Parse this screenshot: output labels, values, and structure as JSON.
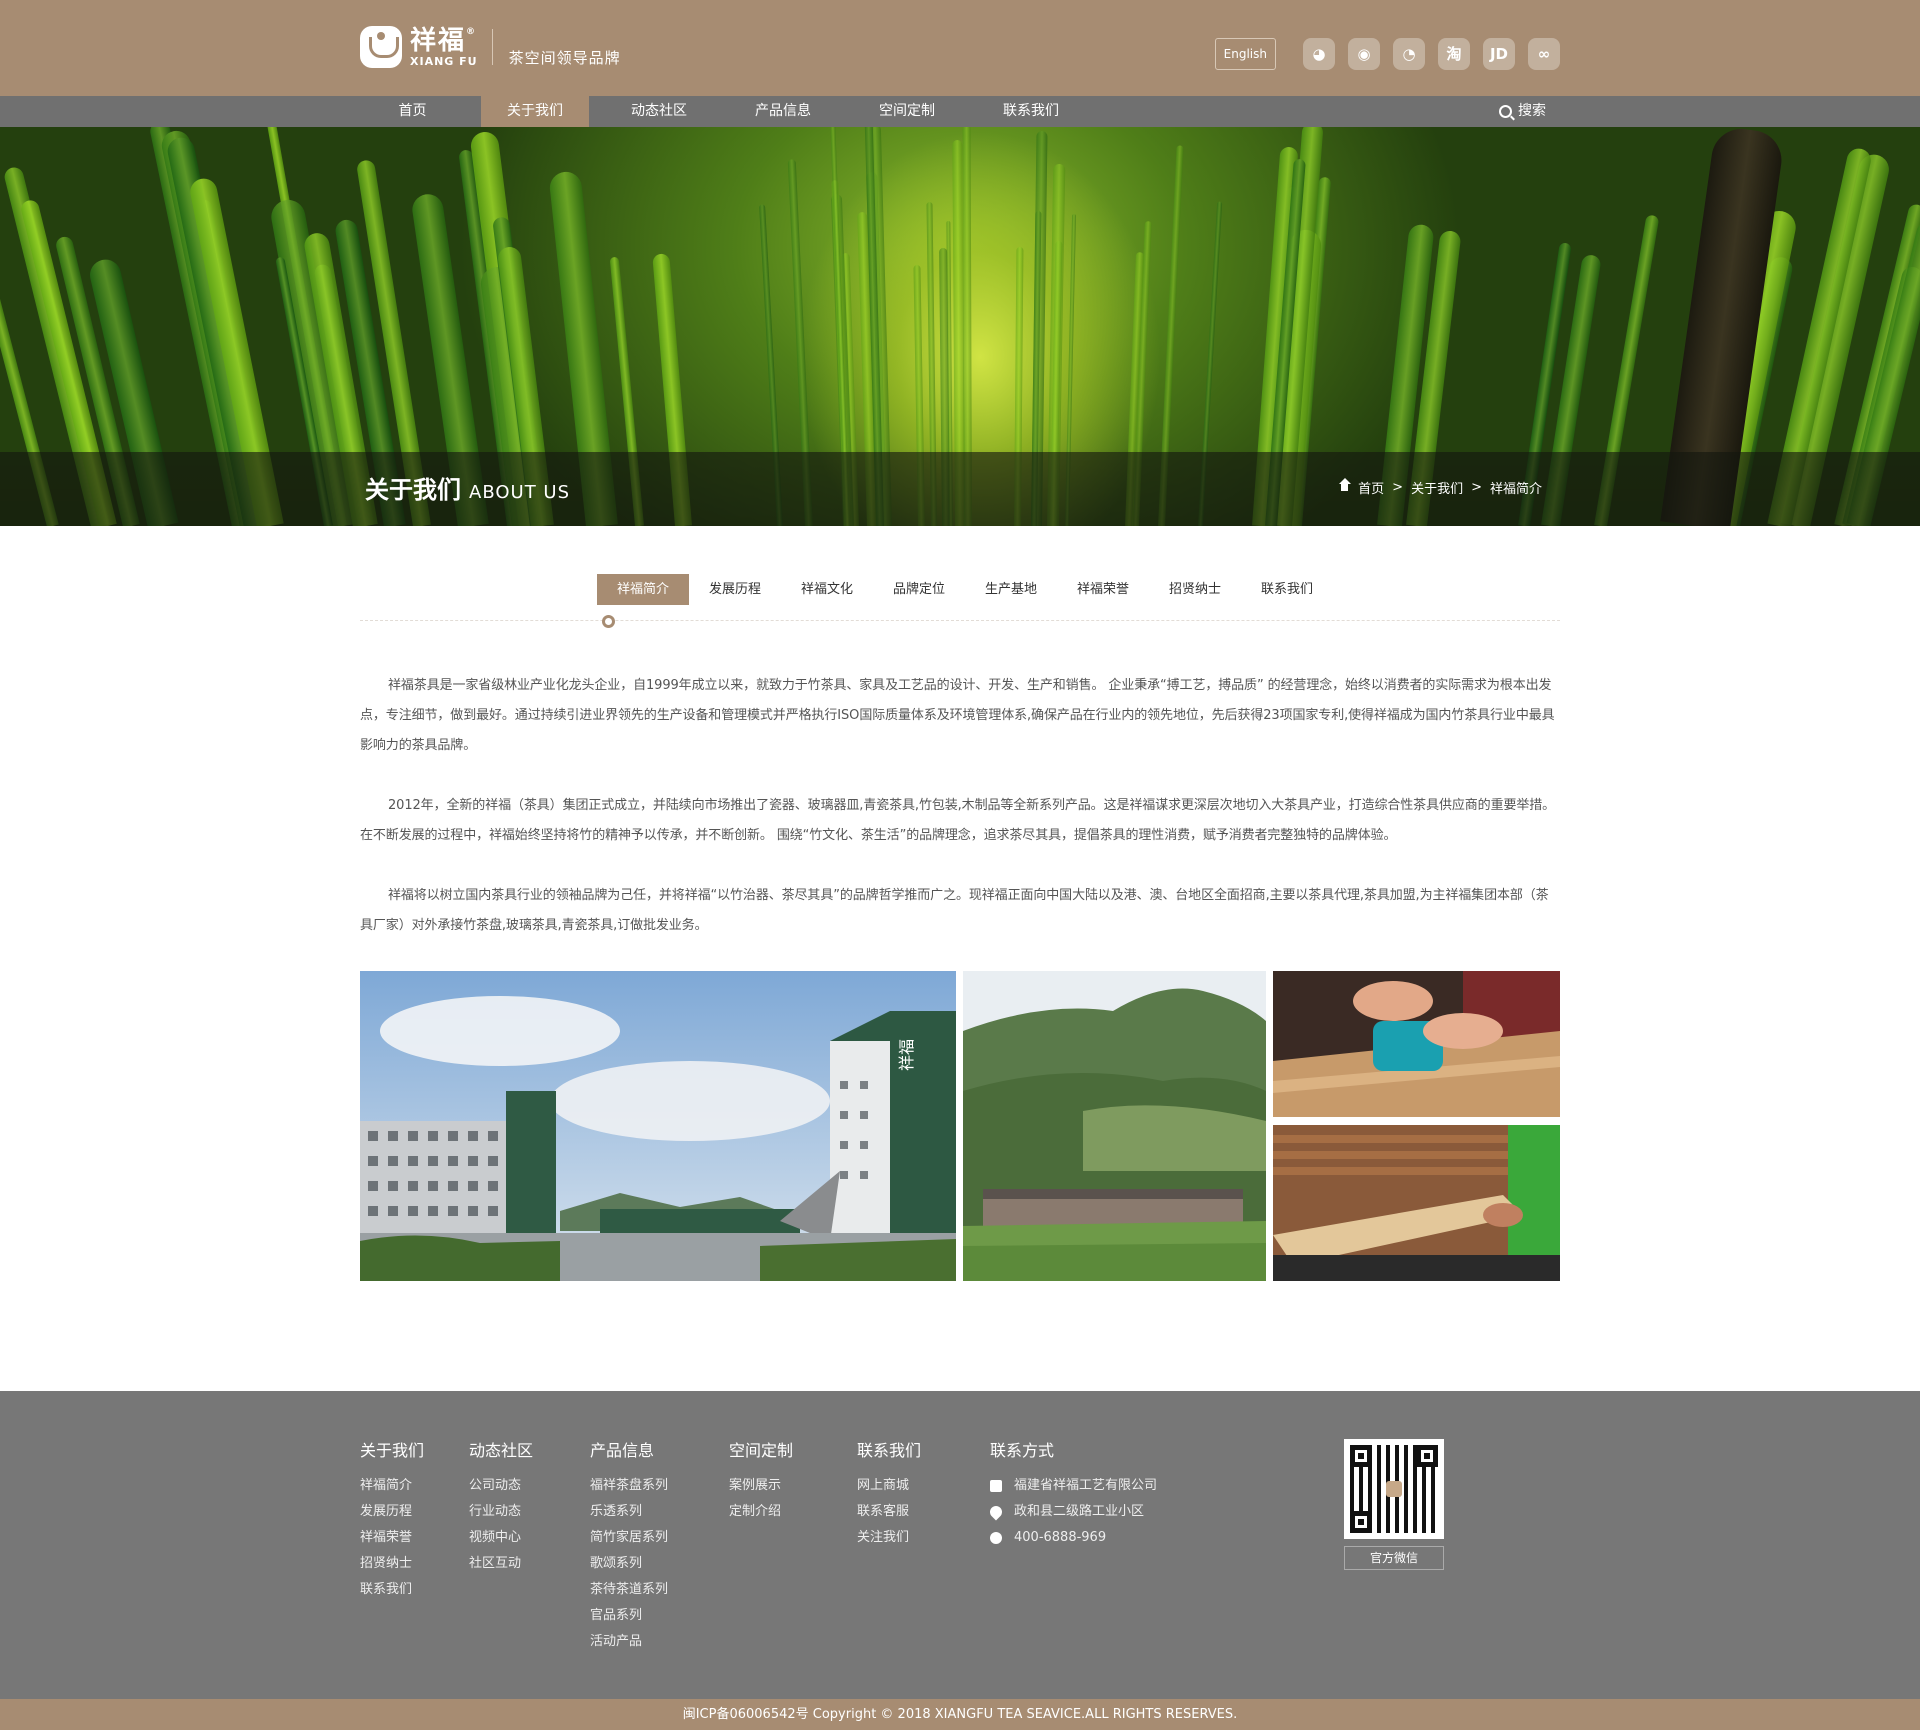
{
  "header": {
    "logo_cn": "祥福",
    "logo_en": "XIANG FU",
    "logo_reg": "®",
    "slogan": "茶空间领导品牌",
    "english_label": "English",
    "social": [
      {
        "icon": "qq-icon",
        "glyph": "◕"
      },
      {
        "icon": "wechat-icon",
        "glyph": "◉"
      },
      {
        "icon": "weibo-icon",
        "glyph": "◔"
      },
      {
        "icon": "taobao-icon",
        "glyph": "淘"
      },
      {
        "icon": "jd-icon",
        "glyph": "JD"
      },
      {
        "icon": "tmall-icon",
        "glyph": "∞"
      }
    ]
  },
  "nav": {
    "items": [
      "首页",
      "关于我们",
      "动态社区",
      "产品信息",
      "空间定制",
      "联系我们"
    ],
    "active_index": 1,
    "search_label": "搜索"
  },
  "banner": {
    "title_cn": "关于我们",
    "title_en": "ABOUT US",
    "breadcrumb": [
      "首页",
      "关于我们",
      "祥福简介"
    ],
    "separator": ">"
  },
  "tabs": {
    "items": [
      "祥福简介",
      "发展历程",
      "祥福文化",
      "品牌定位",
      "生产基地",
      "祥福荣誉",
      "招贤纳士",
      "联系我们"
    ],
    "active_index": 0
  },
  "intro": {
    "paragraphs": [
      "祥福茶具是一家省级林业产业化龙头企业，自1999年成立以来，就致力于竹茶具、家具及工艺品的设计、开发、生产和销售。 企业秉承“搏工艺，搏品质” 的经营理念，始终以消费者的实际需求为根本出发点，专注细节，做到最好。通过持续引进业界领先的生产设备和管理模式并严格执行ISO国际质量体系及环境管理体系,确保产品在行业内的领先地位，先后获得23项国家专利,使得祥福成为国内竹茶具行业中最具影响力的茶具品牌。",
      "2012年，全新的祥福（茶具）集团正式成立，并陆续向市场推出了瓷器、玻璃器皿,青瓷茶具,竹包装,木制品等全新系列产品。这是祥福谋求更深层次地切入大茶具产业，打造综合性茶具供应商的重要举措。 在不断发展的过程中，祥福始终坚持将竹的精神予以传承，并不断创新。 围绕“竹文化、茶生活”的品牌理念，追求茶尽其具，提倡茶具的理性消费，赋予消费者完整独特的品牌体验。",
      "祥福将以树立国内茶具行业的领袖品牌为己任，并将祥福“以竹治器、茶尽其具”的品牌哲学推而广之。现祥福正面向中国大陆以及港、澳、台地区全面招商,主要以茶具代理,茶具加盟,为主祥福集团本部（茶具厂家）对外承接竹茶盘,玻璃茶具,青瓷茶具,订做批发业务。"
    ]
  },
  "photos": {
    "building_sign": "祥福"
  },
  "footer": {
    "columns": [
      {
        "title": "关于我们",
        "links": [
          "祥福简介",
          "发展历程",
          "祥福荣誉",
          "招贤纳士",
          "联系我们"
        ]
      },
      {
        "title": "动态社区",
        "links": [
          "公司动态",
          "行业动态",
          "视频中心",
          "社区互动"
        ]
      },
      {
        "title": "产品信息",
        "links": [
          "福祥茶盘系列",
          "乐透系列",
          "简竹家居系列",
          "歌颂系列",
          "茶待茶道系列",
          "官品系列",
          "活动产品"
        ]
      },
      {
        "title": "空间定制",
        "links": [
          "案例展示",
          "定制介绍"
        ]
      },
      {
        "title": "联系我们",
        "links": [
          "网上商城",
          "联系客服",
          "关注我们"
        ]
      }
    ],
    "contact_title": "联系方式",
    "contact": [
      {
        "icon": "building-icon",
        "text": "福建省祥福工艺有限公司"
      },
      {
        "icon": "location-pin-icon",
        "text": "政和县二级路工业小区"
      },
      {
        "icon": "phone-icon",
        "text": "400-6888-969"
      }
    ],
    "qr_label": "官方微信",
    "copyright": "闽ICP备06006542号 Copyright © 2018 XIANGFU TEA SEAVICE.ALL RIGHTS RESERVES."
  },
  "colors": {
    "brand": "#a78c72",
    "nav_bg": "#707070",
    "footer_bg": "#777777"
  }
}
